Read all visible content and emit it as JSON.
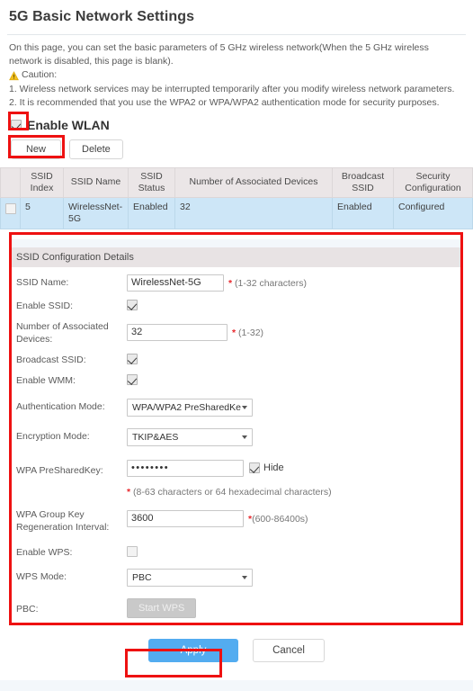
{
  "page": {
    "title": "5G Basic Network Settings",
    "intro_line1": "On this page, you can set the basic parameters of 5 GHz wireless network(When the 5 GHz wireless network is disabled, this page is blank).",
    "caution_label": "Caution:",
    "caution_icon": "warning-triangle-icon",
    "note1": "1. Wireless network services may be interrupted temporarily after you modify wireless network parameters.",
    "note2": "2. It is recommended that you use the WPA2 or WPA/WPA2 authentication mode for security purposes."
  },
  "wlan": {
    "enable_label": "Enable WLAN",
    "enabled": true
  },
  "toolbar": {
    "new_label": "New",
    "delete_label": "Delete"
  },
  "table": {
    "headers": [
      "",
      "SSID Index",
      "SSID Name",
      "SSID Status",
      "Number of Associated Devices",
      "Broadcast SSID",
      "Security Configuration"
    ],
    "rows": [
      {
        "selected": false,
        "ssid_index": "5",
        "ssid_name": "WirelessNet-5G",
        "ssid_status": "Enabled",
        "associated_devices": "32",
        "broadcast_ssid": "Enabled",
        "security_configuration": "Configured"
      }
    ]
  },
  "details": {
    "section_title": "SSID Configuration Details",
    "ssid_name": {
      "label": "SSID Name:",
      "value": "WirelessNet-5G",
      "hint": "(1-32 characters)",
      "required_mark": "*"
    },
    "enable_ssid": {
      "label": "Enable SSID:",
      "checked": true
    },
    "associated_devices": {
      "label": "Number of Associated Devices:",
      "value": "32",
      "hint": "(1-32)",
      "required_mark": "*"
    },
    "broadcast_ssid": {
      "label": "Broadcast SSID:",
      "checked": true
    },
    "enable_wmm": {
      "label": "Enable WMM:",
      "checked": true
    },
    "authentication_mode": {
      "label": "Authentication Mode:",
      "value": "WPA/WPA2 PreSharedKe"
    },
    "encryption_mode": {
      "label": "Encryption Mode:",
      "value": "TKIP&AES"
    },
    "wpa_presharedkey": {
      "label": "WPA PreSharedKey:",
      "value": "••••••••",
      "hide_label": "Hide",
      "hide_checked": true,
      "required_mark": "*",
      "hint": "(8-63 characters or 64 hexadecimal characters)"
    },
    "wpa_group_key": {
      "label": "WPA Group Key Regeneration Interval:",
      "value": "3600",
      "required_mark": "*",
      "hint": "(600-86400s)"
    },
    "enable_wps": {
      "label": "Enable WPS:",
      "checked": false
    },
    "wps_mode": {
      "label": "WPS Mode:",
      "value": "PBC"
    },
    "pbc": {
      "label": "PBC:",
      "button_label": "Start WPS",
      "disabled": true
    }
  },
  "footer": {
    "apply_label": "Apply",
    "cancel_label": "Cancel"
  },
  "colors": {
    "accent_blue": "#53acf0",
    "annotation_red": "#ee1111",
    "row_highlight": "#cde6f7",
    "header_gray": "#ebe6e7",
    "required_red": "#e8272c"
  }
}
